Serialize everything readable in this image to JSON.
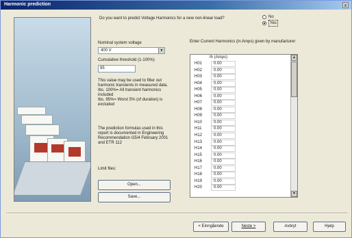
{
  "window": {
    "title": "Harmonic prediction",
    "close_glyph": "x"
  },
  "question": {
    "text": "Do you want to predict Voltage Harmonics for a new non-linear load?",
    "options": [
      "No",
      "Yes"
    ],
    "selected": "Yes"
  },
  "nominal_voltage": {
    "label": "Nominal system voltage",
    "value": "400 V"
  },
  "threshold": {
    "label": "Cumulative threshold (1-100%)",
    "value": "95"
  },
  "info_text": "This value may be used to filter out harmonic transients in measured data.\nIbs. 100%= All transient harmonics included\nIbs. 95%= Worst 5% (of duration) is excluded",
  "formula_text": "The prediction formulas used in this report is documented in Engineering Recommendation G5/4 February 2001 and ETR 112",
  "limit_files": {
    "label": "Limit files:",
    "open_label": "Open...",
    "save_label": "Save..."
  },
  "harmonics": {
    "heading": "Enter Current Harmonics (in Amps) given by manufacturer",
    "column_header": "Ih (Amps)",
    "rows": [
      {
        "h": "H01",
        "v": "0.00"
      },
      {
        "h": "H02",
        "v": "0.00"
      },
      {
        "h": "H03",
        "v": "0.00"
      },
      {
        "h": "H04",
        "v": "0.00"
      },
      {
        "h": "H05",
        "v": "0.00"
      },
      {
        "h": "H06",
        "v": "0.00"
      },
      {
        "h": "H07",
        "v": "0.00"
      },
      {
        "h": "H08",
        "v": "0.00"
      },
      {
        "h": "H09",
        "v": "0.00"
      },
      {
        "h": "H10",
        "v": "0.00"
      },
      {
        "h": "H11",
        "v": "0.00"
      },
      {
        "h": "H12",
        "v": "0.00"
      },
      {
        "h": "H13",
        "v": "0.00"
      },
      {
        "h": "H14",
        "v": "0.00"
      },
      {
        "h": "H15",
        "v": "0.00"
      },
      {
        "h": "H16",
        "v": "0.00"
      },
      {
        "h": "H17",
        "v": "0.00"
      },
      {
        "h": "H18",
        "v": "0.00"
      },
      {
        "h": "H19",
        "v": "0.00"
      },
      {
        "h": "H20",
        "v": "0.00"
      }
    ]
  },
  "footer": {
    "back_label": "< Einngående",
    "next_label": "Neste >",
    "cancel_label": "Avbryt",
    "help_label": "Hjelp"
  },
  "icons": {
    "dropdown": "chevron-down-icon",
    "scroll_up": "arrow-up-icon",
    "scroll_down": "arrow-down-icon"
  },
  "colors": {
    "title_bar": "#0a246a",
    "dialog_bg": "#ece9d8",
    "accent": "#b23a2a"
  }
}
